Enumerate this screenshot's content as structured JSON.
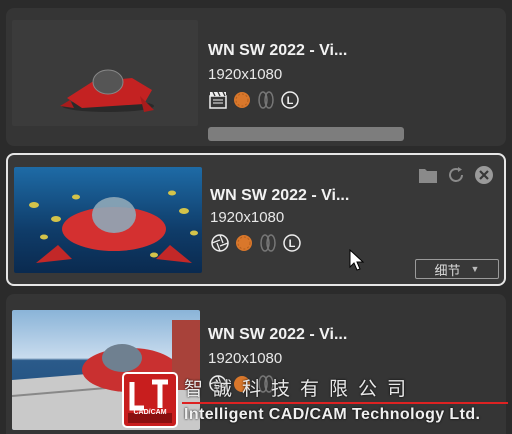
{
  "items": [
    {
      "title": "WN SW 2022 - Vi...",
      "resolution": "1920x1080",
      "selected": false
    },
    {
      "title": "WN SW 2022 - Vi...",
      "resolution": "1920x1080",
      "selected": true
    },
    {
      "title": "WN SW 2022 - Vi...",
      "resolution": "1920x1080",
      "selected": false
    }
  ],
  "detail_button": {
    "label": "细节",
    "arrow": "▼"
  },
  "license_badge": "L",
  "icons": [
    "video-clapper-icon",
    "camera-aperture-icon",
    "orange-sphere-icon",
    "stereo-icon",
    "license-icon",
    "folder-icon",
    "refresh-icon",
    "close-icon"
  ],
  "watermark": {
    "chinese": "智誠科技有限公司",
    "english": "Intelligent CAD/CAM Technology Ltd.",
    "logo_text": "CAD/CAM"
  },
  "colors": {
    "accent": "#d9772b",
    "card": "#353535",
    "background": "#2b2b2b",
    "brand_red": "#d22"
  }
}
